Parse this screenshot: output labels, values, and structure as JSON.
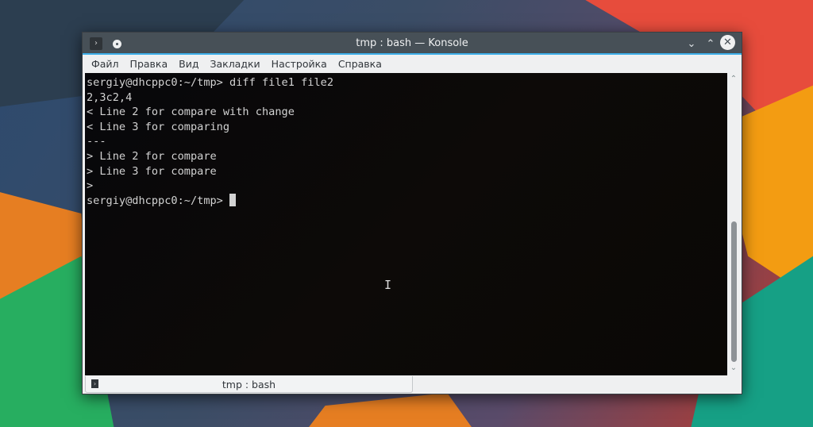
{
  "window": {
    "title": "tmp : bash — Konsole"
  },
  "menu": [
    "Файл",
    "Правка",
    "Вид",
    "Закладки",
    "Настройка",
    "Справка"
  ],
  "terminal": {
    "lines": [
      "sergiy@dhcppc0:~/tmp> diff file1 file2",
      "2,3c2,4",
      "< Line 2 for compare with change",
      "< Line 3 for comparing",
      "---",
      "> Line 2 for compare",
      "> Line 3 for compare",
      ">"
    ],
    "prompt": "sergiy@dhcppc0:~/tmp> "
  },
  "tab": {
    "label": "tmp : bash"
  },
  "colors": {
    "titlebar": "#475057",
    "accent": "#3daee9",
    "terminal_bg": "#0a0808"
  }
}
